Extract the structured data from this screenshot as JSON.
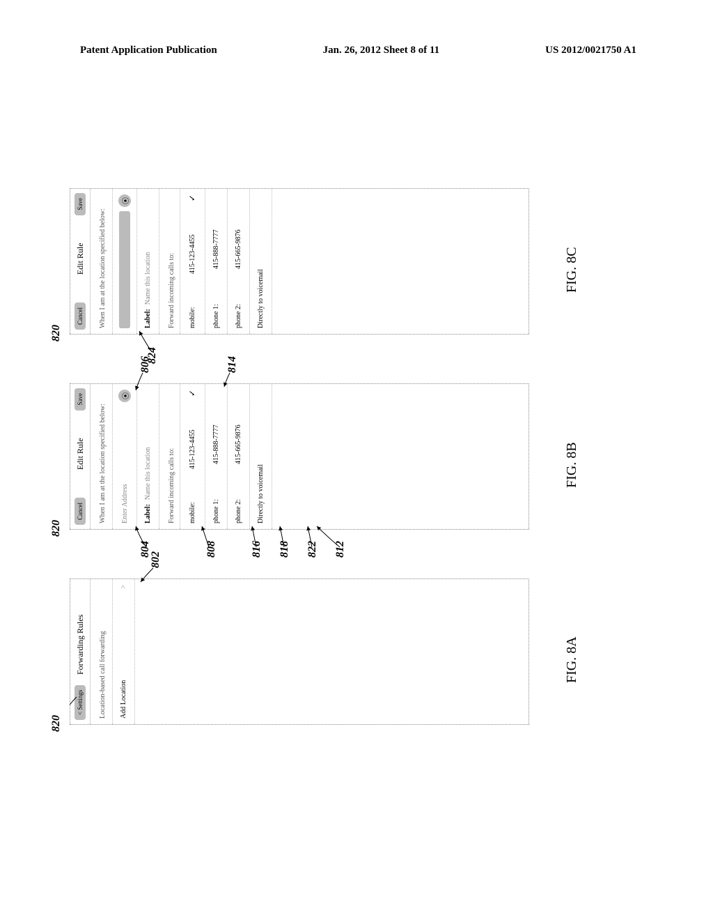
{
  "header": {
    "left": "Patent Application Publication",
    "center": "Jan. 26, 2012  Sheet 8 of 11",
    "right": "US 2012/0021750 A1"
  },
  "fig_a": {
    "ref_top": "820",
    "nav_back": "< Settings",
    "title": "Forwarding Rules",
    "subtitle": "Location-based call forwarding",
    "add_location": "Add Location",
    "chevron": ">",
    "ref_802": "802",
    "caption": "FIG. 8A"
  },
  "fig_b": {
    "ref_top": "820",
    "cancel": "Cancel",
    "title": "Edit Rule",
    "save": "Save",
    "when_line": "When I am at the location specified below:",
    "address_placeholder": "Enter Address",
    "pin_glyph": "⦿",
    "label_key": "Label:",
    "label_placeholder": "Name this location",
    "forward_head": "Forward incoming calls to:",
    "opt_mobile_label": "mobile:",
    "opt_mobile_num": "415-123-4455",
    "opt_p1_label": "phone 1:",
    "opt_p1_num": "415-888-7777",
    "opt_p2_label": "phone 2:",
    "opt_p2_num": "415-665-9876",
    "opt_vm": "Directly to voicemail",
    "check": "✓",
    "ref_804": "804",
    "ref_806": "806",
    "ref_808": "808",
    "ref_812": "812",
    "ref_814": "814",
    "ref_816": "816",
    "ref_818": "818",
    "ref_822": "822",
    "caption": "FIG. 8B"
  },
  "fig_c": {
    "ref_top": "820",
    "cancel": "Cancel",
    "title": "Edit Rule",
    "save": "Save",
    "when_line": "When I am at the location specified below:",
    "address_filled": "(filled address)",
    "pin_glyph": "⦿",
    "label_key": "Label:",
    "label_placeholder": "Name this location",
    "forward_head": "Forward incoming calls to:",
    "opt_mobile_label": "mobile:",
    "opt_mobile_num": "415-123-4455",
    "opt_p1_label": "phone 1:",
    "opt_p1_num": "415-888-7777",
    "opt_p2_label": "phone 2:",
    "opt_p2_num": "415-665-9876",
    "opt_vm": "Directly to voicemail",
    "check": "✓",
    "ref_824": "824",
    "caption": "FIG. 8C"
  }
}
